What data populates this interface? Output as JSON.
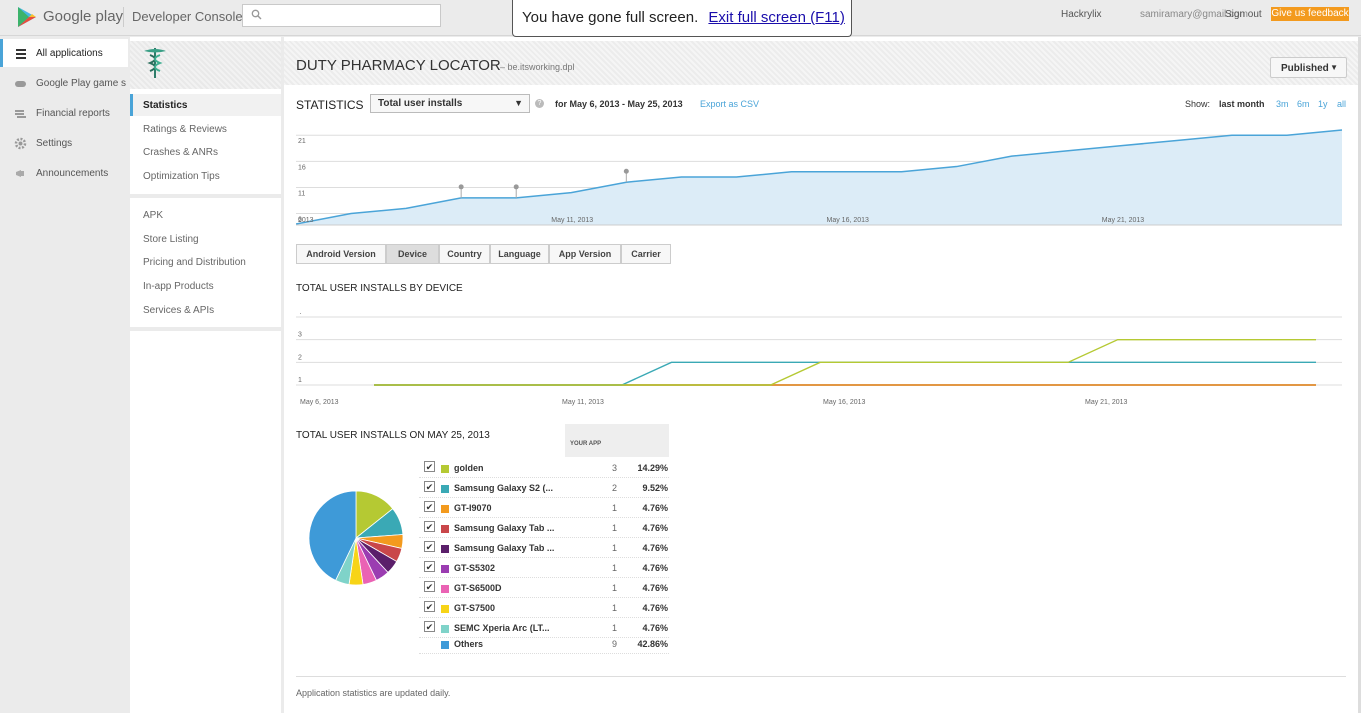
{
  "topbar": {
    "brand": "Google play",
    "console": "Developer Console",
    "search_placeholder": "",
    "fullscreen_msg": "You have gone full screen.",
    "fullscreen_link": "Exit full screen (F11)",
    "user_name": "Hackrylix",
    "user_email": "samiramary@gmail.com",
    "sign_out": "Sign out",
    "feedback": "Give us feedback"
  },
  "leftnav": {
    "items": [
      {
        "label": "All applications",
        "icon": "menu-icon"
      },
      {
        "label": "Google Play game services",
        "icon": "gamepad-icon"
      },
      {
        "label": "Financial reports",
        "icon": "coins-icon"
      },
      {
        "label": "Settings",
        "icon": "gear-icon"
      },
      {
        "label": "Announcements",
        "icon": "megaphone-icon"
      }
    ]
  },
  "appnav": {
    "group1": [
      "Statistics",
      "Ratings & Reviews",
      "Crashes & ANRs",
      "Optimization Tips"
    ],
    "group2": [
      "APK",
      "Store Listing",
      "Pricing and Distribution",
      "In-app Products",
      "Services & APIs"
    ]
  },
  "app": {
    "title": "DUTY PHARMACY LOCATOR",
    "package": "– be.itsworking.dpl",
    "status": "Published"
  },
  "stats": {
    "title": "STATISTICS",
    "metric": "Total user installs",
    "date_range": "for May 6, 2013 - May 25, 2013",
    "export": "Export as CSV",
    "show_label": "Show:",
    "ranges": [
      "last month",
      "3m",
      "6m",
      "1y",
      "all"
    ]
  },
  "tabs": [
    "Android Version",
    "Device",
    "Country",
    "Language",
    "App Version",
    "Carrier"
  ],
  "sections": {
    "by_device": "TOTAL USER INSTALLS BY DEVICE",
    "on_date": "TOTAL USER INSTALLS ON MAY 25, 2013",
    "your_app": "YOUR APP"
  },
  "colors": {
    "accent": "#4aa4d8",
    "golden": "#b5c933",
    "s2": "#3aa9b5",
    "gt9070": "#f39a1e",
    "tab1": "#c9474a",
    "tab2": "#5b1f6a",
    "s5302": "#9b3db1",
    "s6500": "#ea63b4",
    "s7500": "#f7d417",
    "xperia": "#7fd3c9",
    "others": "#3e9ad8"
  },
  "chart_data": [
    {
      "type": "area",
      "title": "",
      "x": [
        "May 6, 2013",
        "May 7",
        "May 8",
        "May 9",
        "May 10",
        "May 11, 2013",
        "May 12",
        "May 13",
        "May 14",
        "May 15",
        "May 16, 2013",
        "May 17",
        "May 18",
        "May 19",
        "May 20",
        "May 21, 2013",
        "May 22",
        "May 23",
        "May 24",
        "May 25"
      ],
      "series": [
        {
          "values": [
            4,
            6,
            7,
            9,
            9,
            10,
            12,
            13,
            13,
            14,
            14,
            14,
            15,
            17,
            18,
            19,
            20,
            21,
            21,
            22
          ]
        }
      ],
      "ylim": [
        4,
        22
      ],
      "yticks": [
        6,
        11,
        16,
        21
      ],
      "xtick_labels": [
        "2013",
        "May 11, 2013",
        "May 16, 2013",
        "May 21, 2013"
      ],
      "annotations": [
        "May 9",
        "May 10",
        "May 12"
      ],
      "grid": true
    },
    {
      "type": "line",
      "title": "TOTAL USER INSTALLS BY DEVICE",
      "x": [
        "May 6, 2013",
        "May 7",
        "May 8",
        "May 9",
        "May 10",
        "May 11, 2013",
        "May 12",
        "May 13",
        "May 14",
        "May 15",
        "May 16, 2013",
        "May 17",
        "May 18",
        "May 19",
        "May 20",
        "May 21, 2013",
        "May 22",
        "May 23",
        "May 24",
        "May 25"
      ],
      "series": [
        {
          "values": [
            1,
            1,
            1,
            1,
            1,
            1,
            1,
            1,
            1,
            2,
            2,
            2,
            2,
            2,
            2,
            3,
            3,
            3,
            3,
            3
          ],
          "color": "#b5c933"
        },
        {
          "values": [
            1,
            1,
            1,
            1,
            1,
            1,
            2,
            2,
            2,
            2,
            2,
            2,
            2,
            2,
            2,
            2,
            2,
            2,
            2,
            2
          ],
          "color": "#3aa9b5"
        },
        {
          "values": [
            1,
            1,
            1,
            1,
            1,
            1,
            1,
            1,
            1,
            1,
            1,
            1,
            1,
            1,
            1,
            1,
            1,
            1,
            1,
            1
          ],
          "color": "#f39a1e"
        },
        {
          "values": [
            1,
            1,
            1,
            1,
            1,
            1,
            1,
            1,
            1,
            1,
            1,
            1,
            1,
            1,
            1,
            1,
            1,
            1,
            1,
            1
          ],
          "color": "#5b1f6a"
        }
      ],
      "ylim": [
        1,
        4
      ],
      "yticks": [
        1,
        2,
        3,
        4
      ],
      "xtick_labels": [
        "May 6, 2013",
        "May 11, 2013",
        "May 16, 2013",
        "May 21, 2013"
      ],
      "grid": true
    },
    {
      "type": "pie",
      "title": "TOTAL USER INSTALLS ON MAY 25, 2013",
      "rows": [
        {
          "name": "golden",
          "count": "3",
          "pct": "14.29%",
          "value": 14.29,
          "color": "#b5c933",
          "checked": true
        },
        {
          "name": "Samsung Galaxy S2 (...",
          "count": "2",
          "pct": "9.52%",
          "value": 9.52,
          "color": "#3aa9b5",
          "checked": true
        },
        {
          "name": "GT-I9070",
          "count": "1",
          "pct": "4.76%",
          "value": 4.76,
          "color": "#f39a1e",
          "checked": true
        },
        {
          "name": "Samsung Galaxy Tab ...",
          "count": "1",
          "pct": "4.76%",
          "value": 4.76,
          "color": "#c9474a",
          "checked": true
        },
        {
          "name": "Samsung Galaxy Tab ...",
          "count": "1",
          "pct": "4.76%",
          "value": 4.76,
          "color": "#5b1f6a",
          "checked": true
        },
        {
          "name": "GT-S5302",
          "count": "1",
          "pct": "4.76%",
          "value": 4.76,
          "color": "#9b3db1",
          "checked": true
        },
        {
          "name": "GT-S6500D",
          "count": "1",
          "pct": "4.76%",
          "value": 4.76,
          "color": "#ea63b4",
          "checked": true
        },
        {
          "name": "GT-S7500",
          "count": "1",
          "pct": "4.76%",
          "value": 4.76,
          "color": "#f7d417",
          "checked": true
        },
        {
          "name": "SEMC Xperia Arc (LT...",
          "count": "1",
          "pct": "4.76%",
          "value": 4.76,
          "color": "#7fd3c9",
          "checked": true
        },
        {
          "name": "Others",
          "count": "9",
          "pct": "42.86%",
          "value": 42.86,
          "color": "#3e9ad8",
          "checked": false
        }
      ]
    }
  ],
  "footer": "Application statistics are updated daily."
}
